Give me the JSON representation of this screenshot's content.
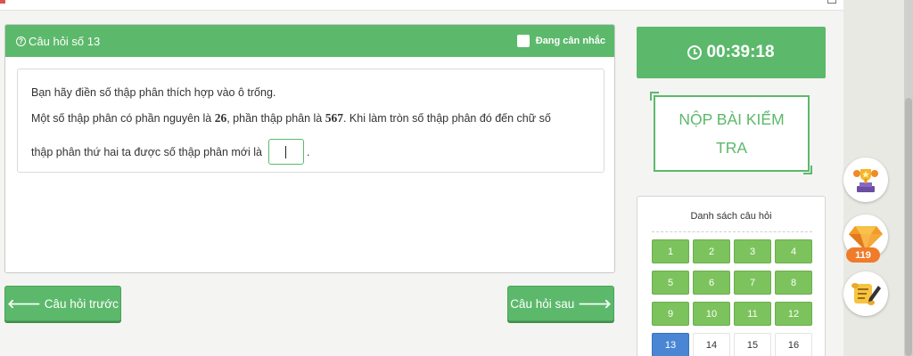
{
  "question": {
    "title": "Câu hỏi số 13",
    "flag_label": "Đang cân nhắc",
    "line1": "Bạn hãy điền số thập phân thích hợp vào ô trống.",
    "line2_a": "Một số thập phân có phần nguyên là ",
    "line2_int": "26",
    "line2_b": ", phần thập phân là ",
    "line2_dec": "567",
    "line2_c": ". Khi làm tròn số thập phân đó đến chữ số",
    "line3_a": "thập phân thứ hai ta được số thập phân mới là",
    "line3_b": ".",
    "answer_value": ""
  },
  "nav": {
    "prev_label": "Câu hỏi trước",
    "next_label": "Câu hỏi sau",
    "prev_icon": "arrow-left-icon",
    "next_icon": "arrow-right-icon"
  },
  "timer": {
    "value": "00:39:18",
    "icon": "clock-icon"
  },
  "submit": {
    "label": "NỘP BÀI KIỂM TRA"
  },
  "question_list": {
    "title": "Danh sách câu hỏi",
    "items": [
      {
        "label": "1",
        "state": "done"
      },
      {
        "label": "2",
        "state": "done"
      },
      {
        "label": "3",
        "state": "done"
      },
      {
        "label": "4",
        "state": "done"
      },
      {
        "label": "5",
        "state": "done"
      },
      {
        "label": "6",
        "state": "done"
      },
      {
        "label": "7",
        "state": "done"
      },
      {
        "label": "8",
        "state": "done"
      },
      {
        "label": "9",
        "state": "done"
      },
      {
        "label": "10",
        "state": "done"
      },
      {
        "label": "11",
        "state": "done"
      },
      {
        "label": "12",
        "state": "done"
      },
      {
        "label": "13",
        "state": "current"
      },
      {
        "label": "14",
        "state": "pending"
      },
      {
        "label": "15",
        "state": "pending"
      },
      {
        "label": "16",
        "state": "pending"
      }
    ]
  },
  "sidebar": {
    "badges": [
      {
        "icon": "trophy-icon"
      },
      {
        "icon": "diamond-icon",
        "count": "119"
      },
      {
        "icon": "scroll-pen-icon"
      }
    ]
  },
  "colors": {
    "accent_green": "#5cb96b",
    "done_green": "#7cc35d",
    "current_blue": "#4a86d4",
    "gem_orange": "#f07b2a"
  }
}
